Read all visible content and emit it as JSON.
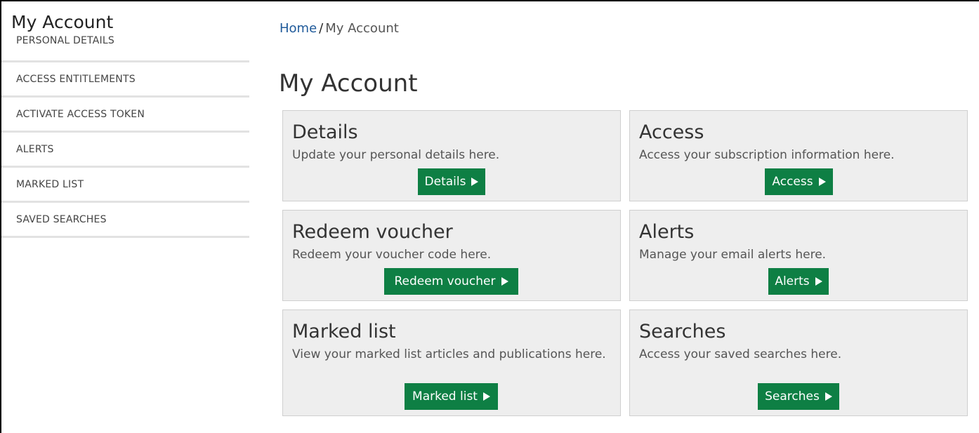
{
  "sidebar": {
    "title": "My Account",
    "items": [
      {
        "label": "PERSONAL DETAILS"
      },
      {
        "label": "ACCESS ENTITLEMENTS"
      },
      {
        "label": "ACTIVATE ACCESS TOKEN"
      },
      {
        "label": "ALERTS"
      },
      {
        "label": "MARKED LIST"
      },
      {
        "label": "SAVED SEARCHES"
      }
    ]
  },
  "breadcrumb": {
    "home": "Home",
    "separator": "/",
    "current": "My Account"
  },
  "main": {
    "title": "My Account",
    "cards": [
      {
        "title": "Details",
        "description": "Update your personal details here.",
        "button": "Details"
      },
      {
        "title": "Access",
        "description": "Access your subscription information here.",
        "button": "Access"
      },
      {
        "title": "Redeem voucher",
        "description": "Redeem your voucher code here.",
        "button": "Redeem voucher"
      },
      {
        "title": "Alerts",
        "description": "Manage your email alerts here.",
        "button": "Alerts"
      },
      {
        "title": "Marked list",
        "description": "View your marked list articles and publications here.",
        "button": "Marked list"
      },
      {
        "title": "Searches",
        "description": "Access your saved searches here.",
        "button": "Searches"
      }
    ]
  },
  "colors": {
    "accent": "#0e7f44",
    "card_bg": "#eeeeee",
    "link": "#1f5a9a"
  },
  "icons": {
    "button_arrow": "play-arrow-icon"
  }
}
